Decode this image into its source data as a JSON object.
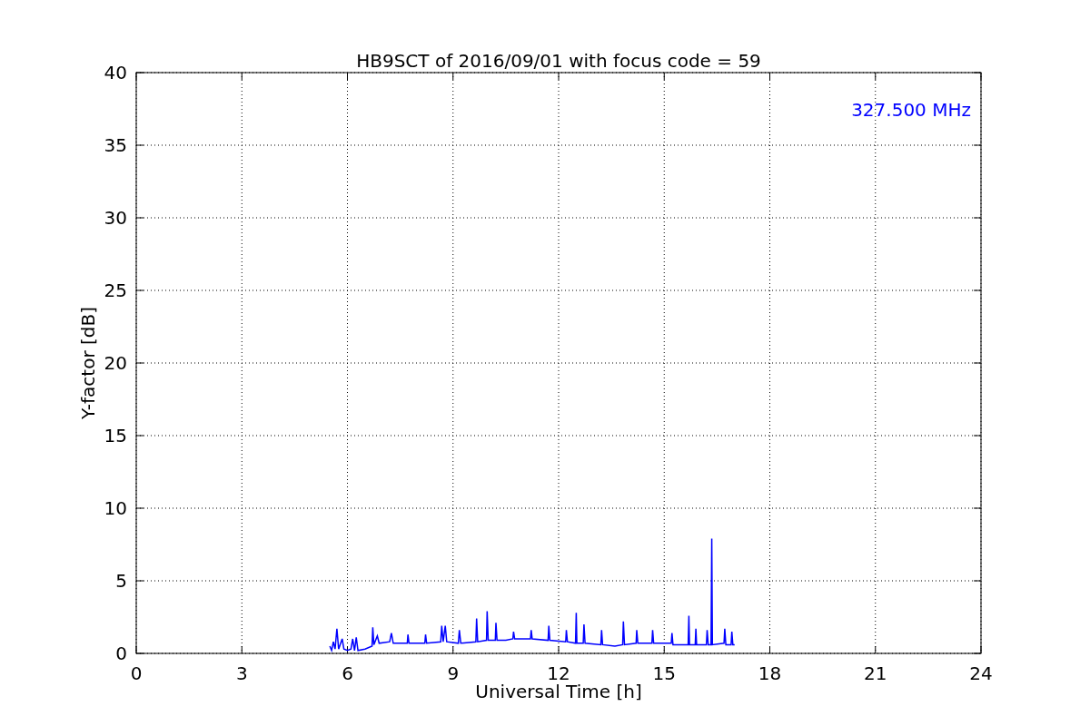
{
  "chart_data": {
    "type": "line",
    "title": "HB9SCT of 2016/09/01 with focus code = 59",
    "xlabel": "Universal Time [h]",
    "ylabel": "Y-factor [dB]",
    "xlim": [
      0,
      24
    ],
    "ylim": [
      0,
      40
    ],
    "xticks": [
      0,
      3,
      6,
      9,
      12,
      15,
      18,
      21,
      24
    ],
    "yticks": [
      0,
      5,
      10,
      15,
      20,
      25,
      30,
      35,
      40
    ],
    "grid": true,
    "annotations": [
      {
        "text": "327.500 MHz"
      }
    ],
    "x": [
      5.5,
      5.55,
      5.6,
      5.65,
      5.7,
      5.75,
      5.85,
      5.9,
      6.0,
      6.1,
      6.15,
      6.2,
      6.25,
      6.3,
      6.5,
      6.7,
      6.72,
      6.75,
      6.85,
      6.9,
      7.2,
      7.25,
      7.3,
      7.7,
      7.72,
      7.75,
      8.2,
      8.22,
      8.25,
      8.65,
      8.68,
      8.72,
      8.78,
      8.82,
      9.15,
      9.18,
      9.22,
      9.65,
      9.67,
      9.7,
      9.95,
      9.97,
      10.0,
      10.2,
      10.22,
      10.25,
      10.5,
      10.7,
      10.72,
      10.75,
      11.2,
      11.22,
      11.25,
      11.7,
      11.72,
      11.75,
      12.2,
      12.22,
      12.25,
      12.48,
      12.5,
      12.52,
      12.7,
      12.72,
      12.75,
      13.2,
      13.22,
      13.25,
      13.6,
      13.82,
      13.84,
      13.87,
      14.2,
      14.22,
      14.25,
      14.65,
      14.67,
      14.7,
      15.2,
      15.22,
      15.25,
      15.68,
      15.7,
      15.72,
      15.88,
      15.9,
      15.92,
      16.2,
      16.22,
      16.25,
      16.33,
      16.35,
      16.37,
      16.7,
      16.72,
      16.75,
      16.9,
      16.92,
      16.95,
      17.0
    ],
    "series": [
      {
        "color": "#0000ff",
        "values": [
          0.5,
          0.2,
          0.8,
          0.3,
          1.7,
          0.3,
          1.0,
          0.3,
          0.2,
          0.3,
          1.0,
          0.2,
          1.1,
          0.2,
          0.3,
          0.5,
          1.8,
          0.6,
          1.2,
          0.7,
          0.8,
          1.4,
          0.7,
          0.7,
          1.3,
          0.7,
          0.7,
          1.3,
          0.7,
          0.8,
          1.9,
          0.8,
          1.9,
          0.8,
          0.7,
          1.6,
          0.7,
          0.8,
          2.4,
          0.8,
          0.9,
          2.9,
          0.9,
          0.9,
          2.1,
          0.9,
          0.9,
          1.0,
          1.5,
          1.0,
          1.0,
          1.6,
          1.0,
          0.9,
          1.9,
          0.9,
          0.8,
          1.6,
          0.8,
          0.7,
          2.8,
          0.7,
          0.7,
          2.0,
          0.7,
          0.6,
          1.6,
          0.6,
          0.5,
          0.6,
          2.2,
          0.6,
          0.7,
          1.6,
          0.7,
          0.7,
          1.6,
          0.7,
          0.7,
          1.4,
          0.6,
          0.6,
          2.6,
          0.6,
          0.6,
          1.7,
          0.6,
          0.6,
          1.6,
          0.6,
          0.6,
          7.9,
          0.6,
          0.7,
          1.7,
          0.6,
          0.6,
          1.5,
          0.6,
          0.6
        ]
      }
    ]
  }
}
